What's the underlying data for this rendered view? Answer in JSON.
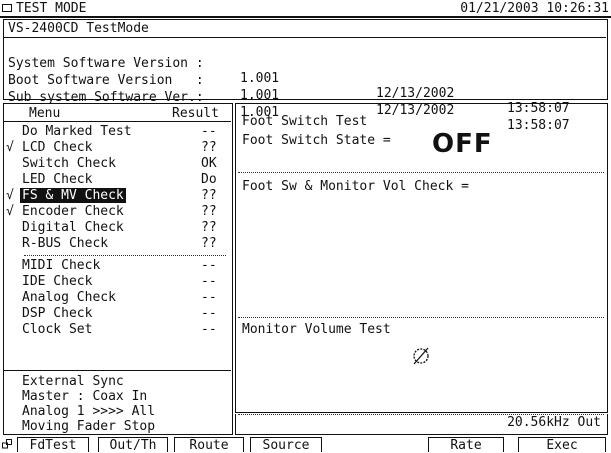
{
  "titlebar": {
    "title": "TEST MODE",
    "datetime": "01/21/2003 10:26:31"
  },
  "info": {
    "model": "VS-2400CD TestMode",
    "rows": [
      {
        "name": "System Software Version :",
        "version": "1.001",
        "date": "12/13/2002",
        "time": "13:58:07"
      },
      {
        "name": "Boot Software Version   :",
        "version": "1.001",
        "date": "12/13/2002",
        "time": "13:58:07"
      },
      {
        "name": "Sub system Software Ver.:",
        "version": "1.001",
        "date": "",
        "time": ""
      }
    ]
  },
  "menu": {
    "header_name": "Menu",
    "header_result": "Result",
    "items": [
      {
        "check": "",
        "name": "Do Marked Test",
        "result": "--",
        "selected": false
      },
      {
        "check": "√",
        "name": "LCD Check",
        "result": "??",
        "selected": false
      },
      {
        "check": "",
        "name": "Switch Check",
        "result": "OK",
        "selected": false
      },
      {
        "check": "",
        "name": "LED Check",
        "result": "Do",
        "selected": false
      },
      {
        "check": "√",
        "name": "FS & MV Check",
        "result": "??",
        "selected": true
      },
      {
        "check": "√",
        "name": "Encoder Check",
        "result": "??",
        "selected": false
      },
      {
        "check": "",
        "name": "Digital Check",
        "result": "??",
        "selected": false
      },
      {
        "check": "",
        "name": "R-BUS Check",
        "result": "??",
        "selected": false
      },
      {
        "check": "",
        "name": "MIDI Check",
        "result": "--",
        "selected": false
      },
      {
        "check": "",
        "name": "IDE Check",
        "result": "--",
        "selected": false
      },
      {
        "check": "",
        "name": "Analog Check",
        "result": "--",
        "selected": false
      },
      {
        "check": "",
        "name": "DSP Check",
        "result": "--",
        "selected": false
      },
      {
        "check": "",
        "name": "Clock Set",
        "result": "--",
        "selected": false
      }
    ],
    "sync": [
      "External Sync",
      "Master : Coax In",
      "Analog 1 >>>> All",
      "Moving Fader Stop"
    ]
  },
  "right": {
    "fs_test_label": "Foot Switch Test",
    "fs_state_label": "Foot Switch State =",
    "fs_state_value": "OFF",
    "monitor_check_label": "Foot Sw & Monitor Vol Check =",
    "monitor_test_label": "Monitor Volume Test",
    "null_symbol": "Ø",
    "frequency": "20.56kHz Out"
  },
  "function_keys": [
    "FdTest",
    "Out/Th",
    "Route",
    "Source",
    "Rate",
    "Exec"
  ]
}
